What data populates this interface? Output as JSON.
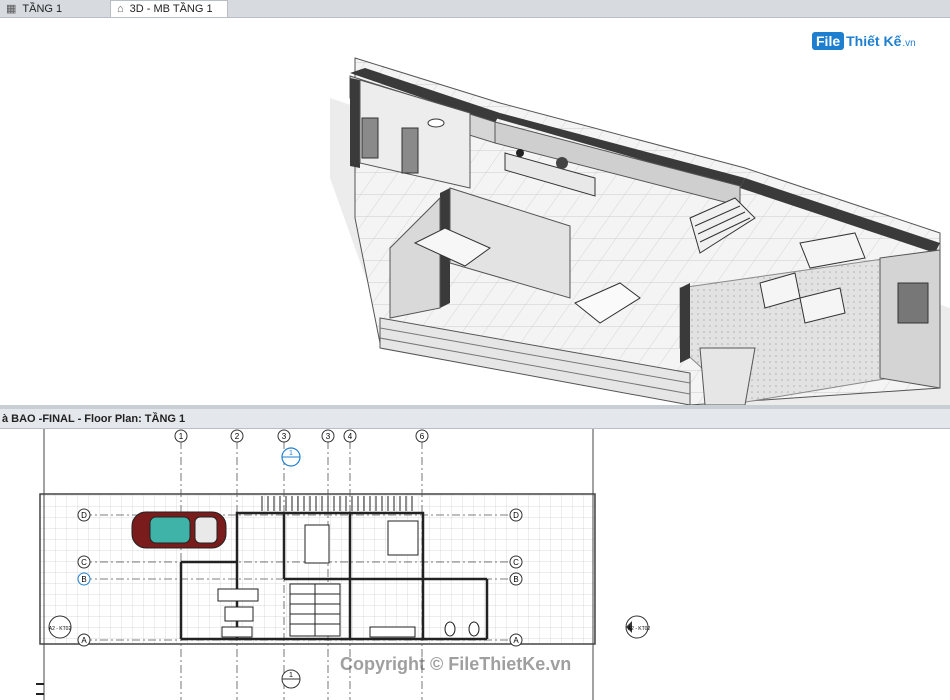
{
  "tabs": [
    {
      "label": "TẦNG 1",
      "icon": "floor-plan-icon"
    },
    {
      "label": "3D -  MB TẦNG 1",
      "icon": "3d-house-icon"
    }
  ],
  "logo": {
    "box": "File",
    "text": "Thiết Kế",
    "suffix": ".vn"
  },
  "plan_view": {
    "title": "à BAO -FINAL - Floor Plan: TẦNG 1"
  },
  "grid": {
    "columns": [
      "1",
      "2",
      "3",
      "3",
      "4",
      "6"
    ],
    "rows": [
      "D",
      "C",
      "B",
      "A"
    ],
    "section_marks": [
      "1",
      "1"
    ],
    "elevation_tags": [
      "A2 - KT02",
      "A2 - KT02"
    ]
  },
  "watermark": "Copyright © FileThietKe.vn",
  "colors": {
    "wall": "#404040",
    "floor_grid": "#d0d0d0",
    "accent_blue": "#1e7fd0",
    "grid_line": "#555555"
  }
}
